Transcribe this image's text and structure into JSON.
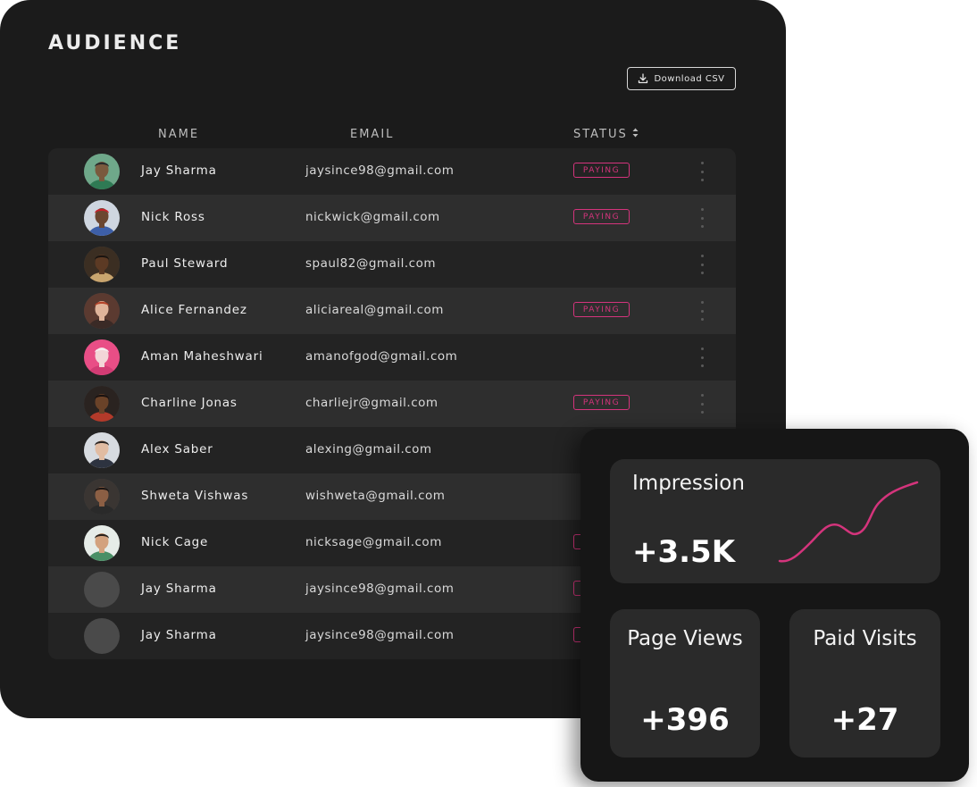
{
  "panel": {
    "title": "AUDIENCE",
    "download_label": "Download CSV",
    "columns": {
      "name": "NAME",
      "email": "EMAIL",
      "status": "STATUS"
    }
  },
  "rows": [
    {
      "name": "Jay Sharma",
      "email": "jaysince98@gmail.com",
      "status": "PAYING",
      "avatar": "photo"
    },
    {
      "name": "Nick Ross",
      "email": "nickwick@gmail.com",
      "status": "PAYING",
      "avatar": "photo"
    },
    {
      "name": "Paul Steward",
      "email": "spaul82@gmail.com",
      "status": "",
      "avatar": "photo"
    },
    {
      "name": "Alice Fernandez",
      "email": "aliciareal@gmail.com",
      "status": "PAYING",
      "avatar": "photo"
    },
    {
      "name": "Aman Maheshwari",
      "email": "amanofgod@gmail.com",
      "status": "",
      "avatar": "photo"
    },
    {
      "name": "Charline Jonas",
      "email": "charliejr@gmail.com",
      "status": "PAYING",
      "avatar": "photo"
    },
    {
      "name": "Alex Saber",
      "email": "alexing@gmail.com",
      "status": "",
      "avatar": "photo"
    },
    {
      "name": "Shweta Vishwas",
      "email": "wishweta@gmail.com",
      "status": "",
      "avatar": "photo"
    },
    {
      "name": "Nick Cage",
      "email": "nicksage@gmail.com",
      "status": "PAYING",
      "avatar": "photo"
    },
    {
      "name": "Jay Sharma",
      "email": "jaysince98@gmail.com",
      "status": "PAYING",
      "avatar": "placeholder"
    },
    {
      "name": "Jay Sharma",
      "email": "jaysince98@gmail.com",
      "status": "PAYING",
      "avatar": "placeholder"
    }
  ],
  "stats": {
    "impression": {
      "label": "Impression",
      "value": "+3.5K"
    },
    "page_views": {
      "label": "Page Views",
      "value": "+396"
    },
    "paid_visits": {
      "label": "Paid Visits",
      "value": "+27"
    }
  },
  "colors": {
    "panel_bg": "#1b1b1b",
    "row_bg": "#232323",
    "row_alt_bg": "#2e2e2e",
    "accent": "#d4347c",
    "stats_bg": "#161616",
    "tile_bg": "#2a2a2a"
  },
  "icons": {
    "download": "download-icon",
    "sort": "sort-arrows-icon",
    "row_menu": "more-vertical-icon"
  }
}
